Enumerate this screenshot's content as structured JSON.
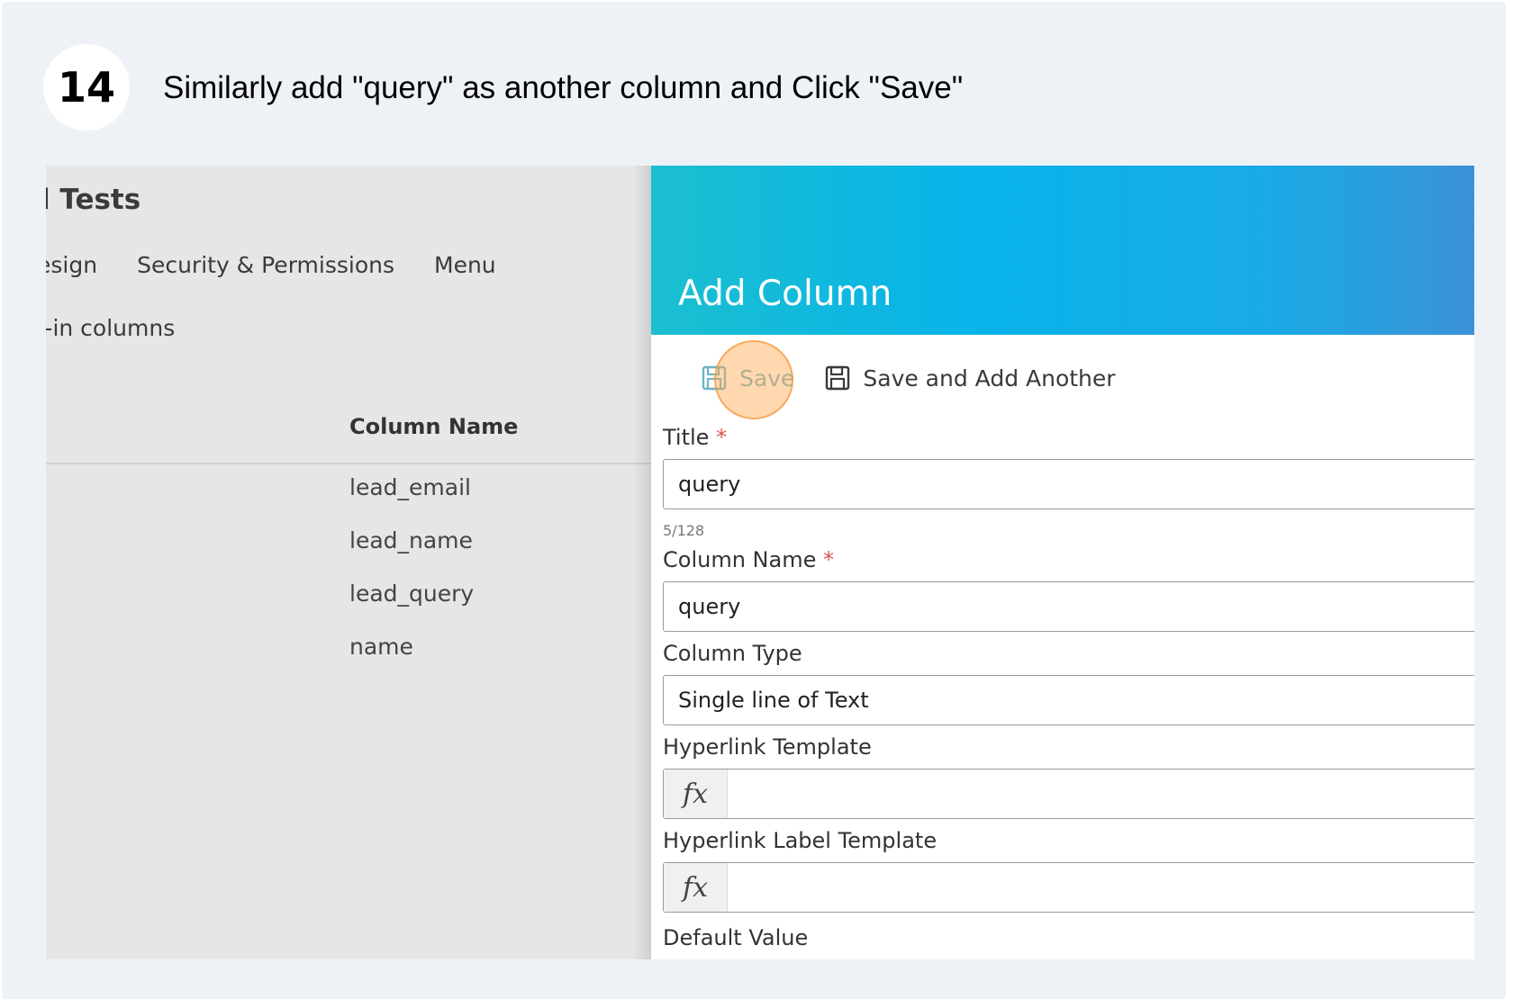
{
  "step": {
    "number": "14",
    "instruction": "Similarly add \"query\" as another column and Click \"Save\""
  },
  "background": {
    "title": "l Tests",
    "tabs": [
      {
        "label": "esign"
      },
      {
        "label": "Security & Permissions"
      },
      {
        "label": "Menu"
      }
    ],
    "subnav": ":-in columns",
    "table": {
      "header": "Column Name",
      "rows": [
        "lead_email",
        "lead_name",
        "lead_query",
        "name"
      ]
    }
  },
  "dialog": {
    "title": "Add Column",
    "toolbar": {
      "save_label": "Save",
      "save_another_label": "Save and Add Another"
    },
    "fields": {
      "title_label": "Title",
      "title_value": "query",
      "title_counter": "5/128",
      "column_name_label": "Column Name",
      "column_name_value": "query",
      "column_type_label": "Column Type",
      "column_type_value": "Single line of Text",
      "hyperlink_template_label": "Hyperlink Template",
      "hyperlink_label_template_label": "Hyperlink Label Template",
      "fx": "fx",
      "default_value_label": "Default Value",
      "required_mark": "*"
    },
    "icons": {
      "save": "floppy-disk-icon",
      "save_another": "floppy-disk-icon"
    },
    "colors": {
      "header_start": "#1bbfd0",
      "header_end": "#3b92d6",
      "save_accent": "#6fb3c8",
      "required": "#d9534f",
      "click_highlight": "#ffa850"
    }
  }
}
